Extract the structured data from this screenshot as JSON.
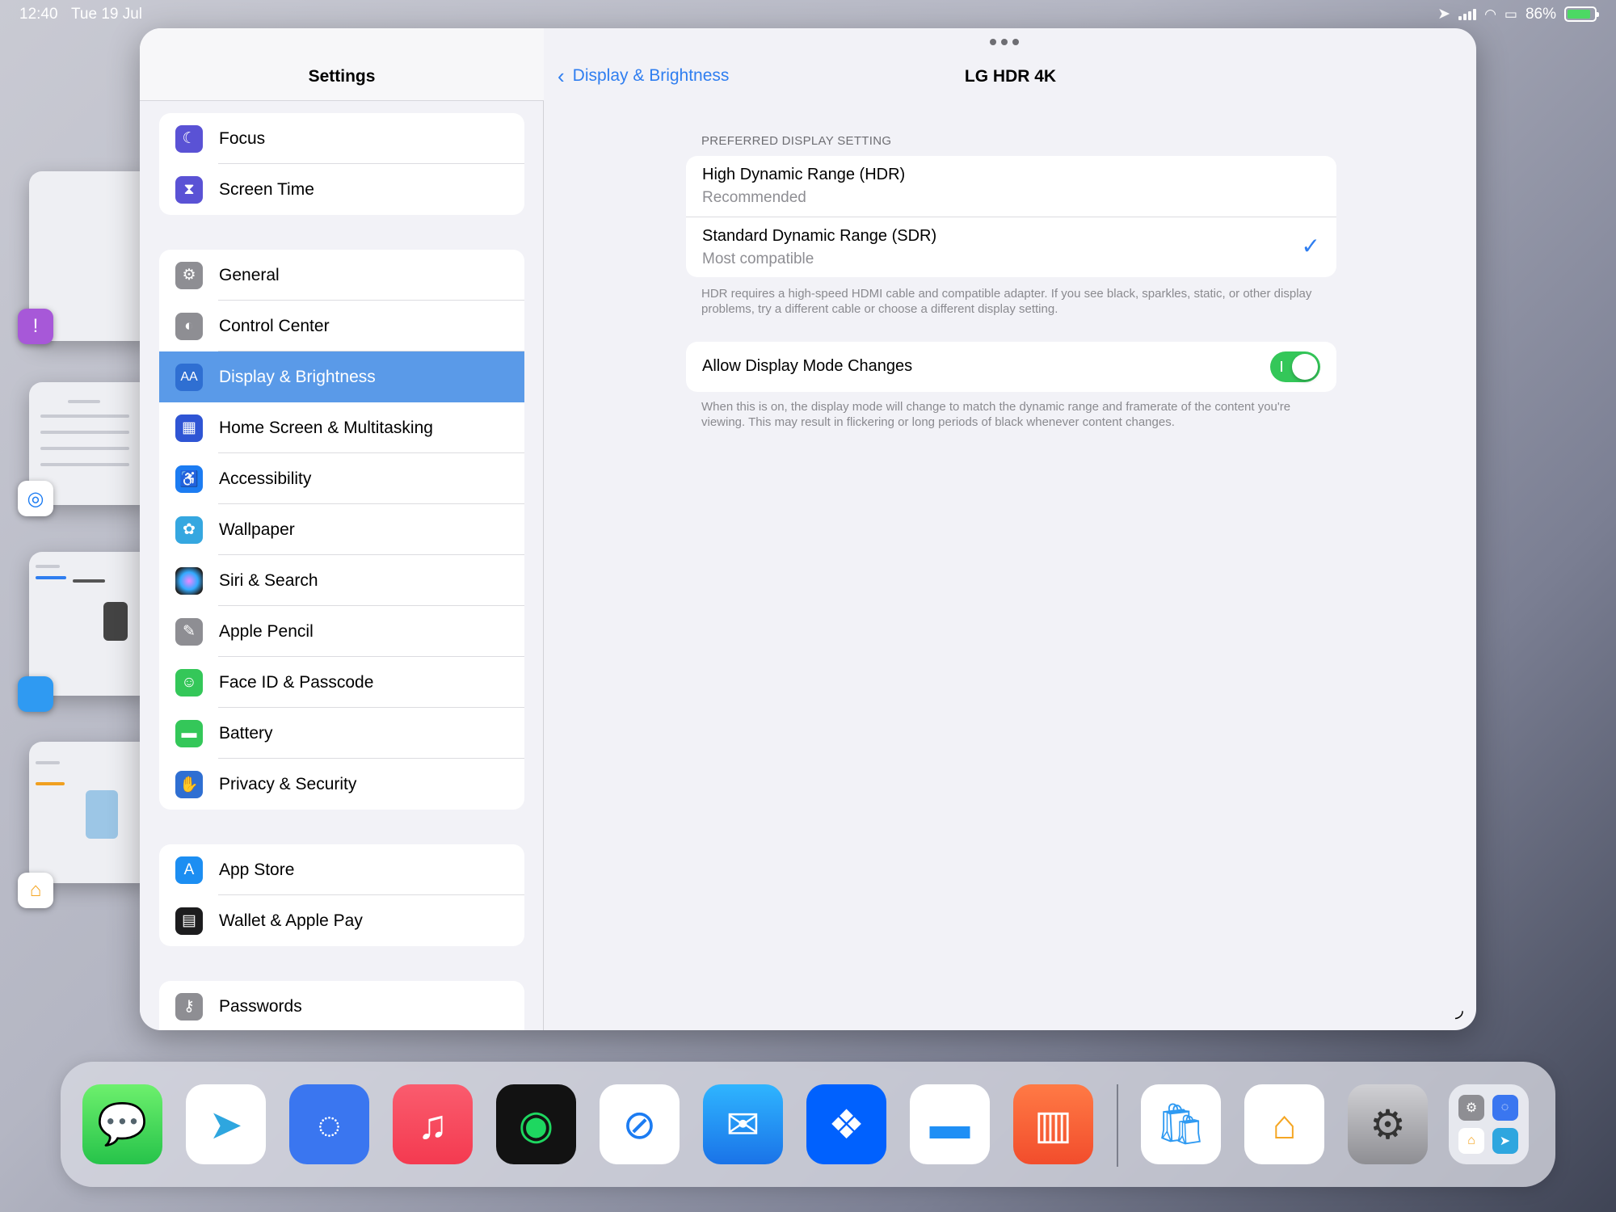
{
  "status_bar": {
    "time": "12:40",
    "date": "Tue 19 Jul",
    "battery": "86%"
  },
  "sidebar": {
    "title": "Settings",
    "groups": [
      {
        "items": [
          {
            "label": "Focus",
            "icon": "moon-icon",
            "color": "#5a52d5"
          },
          {
            "label": "Screen Time",
            "icon": "hourglass-icon",
            "color": "#5a52d5"
          }
        ]
      },
      {
        "items": [
          {
            "label": "General",
            "icon": "gear-icon",
            "color": "#8e8e93"
          },
          {
            "label": "Control Center",
            "icon": "toggles-icon",
            "color": "#8e8e93"
          },
          {
            "label": "Display & Brightness",
            "icon": "text-size-icon",
            "color": "#2f6fd2",
            "selected": true
          },
          {
            "label": "Home Screen & Multitasking",
            "icon": "grid-icon",
            "color": "#2f55d4"
          },
          {
            "label": "Accessibility",
            "icon": "accessibility-icon",
            "color": "#1c7cf2"
          },
          {
            "label": "Wallpaper",
            "icon": "flower-icon",
            "color": "#35a7e0"
          },
          {
            "label": "Siri & Search",
            "icon": "siri-icon",
            "color": "#222"
          },
          {
            "label": "Apple Pencil",
            "icon": "pencil-icon",
            "color": "#8e8e93"
          },
          {
            "label": "Face ID & Passcode",
            "icon": "face-id-icon",
            "color": "#34c759"
          },
          {
            "label": "Battery",
            "icon": "battery-icon",
            "color": "#34c759"
          },
          {
            "label": "Privacy & Security",
            "icon": "hand-icon",
            "color": "#2f6fd2"
          }
        ]
      },
      {
        "items": [
          {
            "label": "App Store",
            "icon": "app-store-icon",
            "color": "#1c8ef2"
          },
          {
            "label": "Wallet & Apple Pay",
            "icon": "wallet-icon",
            "color": "#1c1c1e"
          }
        ]
      },
      {
        "items": [
          {
            "label": "Passwords",
            "icon": "key-icon",
            "color": "#8e8e93"
          }
        ]
      }
    ]
  },
  "detail": {
    "back_label": "Display & Brightness",
    "title": "LG HDR 4K",
    "section_label": "PREFERRED DISPLAY SETTING",
    "options": [
      {
        "title": "High Dynamic Range (HDR)",
        "subtitle": "Recommended",
        "checked": false
      },
      {
        "title": "Standard Dynamic Range (SDR)",
        "subtitle": "Most compatible",
        "checked": true
      }
    ],
    "options_footer": "HDR requires a high-speed HDMI cable and compatible adapter. If you see black, sparkles, static, or other display problems, try a different cable or choose a different display setting.",
    "toggle_label": "Allow Display Mode Changes",
    "toggle_on": true,
    "toggle_footer": "When this is on, the display mode will change to match the dynamic range and framerate of the content you're viewing. This may result in flickering or long periods of black whenever content changes."
  },
  "dock": {
    "apps": [
      "Messages",
      "Telegram",
      "Signal",
      "Music",
      "Spotify",
      "Safari",
      "Mail",
      "Dropbox",
      "Files",
      "Books"
    ],
    "recent": [
      "Apple Store",
      "Home",
      "Settings",
      "App Library"
    ]
  },
  "colors": {
    "accent": "#2f7ef0",
    "selected_row": "#5a9ae8",
    "toggle_on": "#34c759"
  }
}
